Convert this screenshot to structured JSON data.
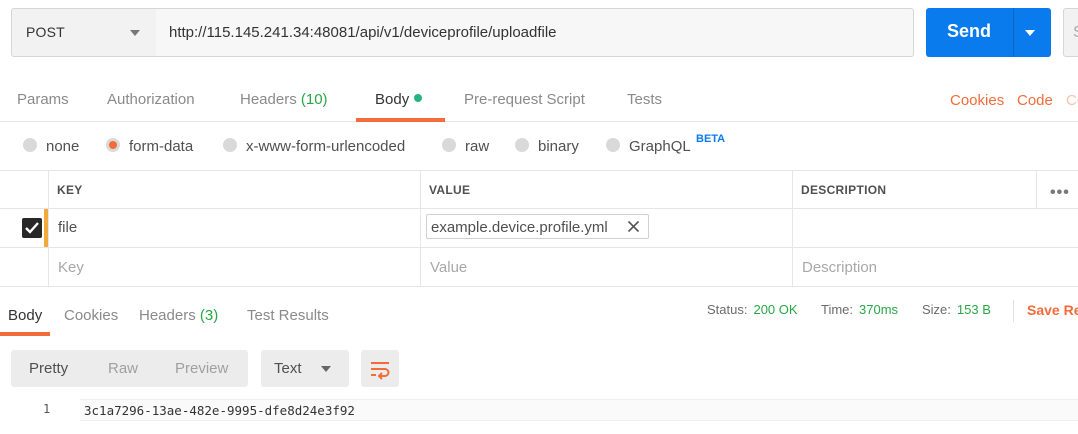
{
  "request": {
    "method": "POST",
    "url": "http://115.145.241.34:48081/api/v1/deviceprofile/uploadfile",
    "send_label": "Send",
    "save_partial": "S"
  },
  "req_tabs": {
    "params": "Params",
    "authorization": "Authorization",
    "headers": "Headers",
    "headers_count": "(10)",
    "body": "Body",
    "prerequest": "Pre-request Script",
    "tests": "Tests",
    "cookies": "Cookies",
    "code": "Code",
    "comments_partial": "Co"
  },
  "body_types": {
    "none": "none",
    "form_data": "form-data",
    "urlencoded": "x-www-form-urlencoded",
    "raw": "raw",
    "binary": "binary",
    "graphql": "GraphQL",
    "beta": "BETA"
  },
  "form_table": {
    "headers": {
      "key": "KEY",
      "value": "VALUE",
      "description": "DESCRIPTION"
    },
    "more": "•••",
    "row": {
      "key": "file",
      "value": "example.device.profile.yml"
    },
    "placeholders": {
      "key": "Key",
      "value": "Value",
      "description": "Description"
    }
  },
  "resp_tabs": {
    "body": "Body",
    "cookies": "Cookies",
    "headers": "Headers",
    "headers_count": "(3)",
    "test_results": "Test Results"
  },
  "resp_stats": {
    "status_label": "Status:",
    "status_value": "200 OK",
    "time_label": "Time:",
    "time_value": "370ms",
    "size_label": "Size:",
    "size_value": "153 B",
    "save_response": "Save Re"
  },
  "resp_view": {
    "pretty": "Pretty",
    "raw": "Raw",
    "preview": "Preview",
    "format": "Text"
  },
  "resp_body": {
    "line_number": "1",
    "content": "3c1a7296-13ae-482e-9995-dfe8d24e3f92"
  },
  "colors": {
    "accent": "#f26b3a",
    "send": "#097bed",
    "success": "#28a745",
    "body_dot": "#26b47f",
    "key_bar": "#f2a93b"
  }
}
